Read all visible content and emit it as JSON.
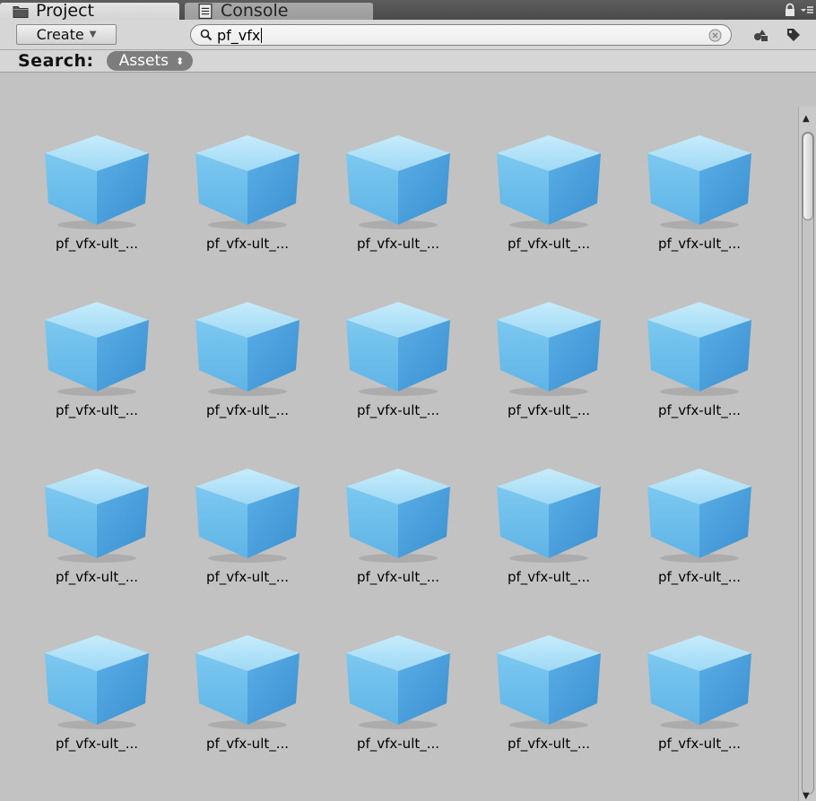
{
  "tabs": [
    {
      "label": "Project",
      "icon": "folder-icon",
      "active": true
    },
    {
      "label": "Console",
      "icon": "console-icon",
      "active": false
    }
  ],
  "tabbar_icons": [
    "lock-icon",
    "panel-menu-icon"
  ],
  "toolbar": {
    "create_label": "Create",
    "search_value": "pf_vfx",
    "filter_icons": [
      "filter-by-type-icon",
      "filter-by-label-icon"
    ]
  },
  "search_scope": {
    "label": "Search:",
    "value": "Assets"
  },
  "assets": [
    {
      "name": "pf_vfx-ult_...",
      "icon": "prefab-cube-icon"
    },
    {
      "name": "pf_vfx-ult_...",
      "icon": "prefab-cube-icon"
    },
    {
      "name": "pf_vfx-ult_...",
      "icon": "prefab-cube-icon"
    },
    {
      "name": "pf_vfx-ult_...",
      "icon": "prefab-cube-icon"
    },
    {
      "name": "pf_vfx-ult_...",
      "icon": "prefab-cube-icon"
    },
    {
      "name": "pf_vfx-ult_...",
      "icon": "prefab-cube-icon"
    },
    {
      "name": "pf_vfx-ult_...",
      "icon": "prefab-cube-icon"
    },
    {
      "name": "pf_vfx-ult_...",
      "icon": "prefab-cube-icon"
    },
    {
      "name": "pf_vfx-ult_...",
      "icon": "prefab-cube-icon"
    },
    {
      "name": "pf_vfx-ult_...",
      "icon": "prefab-cube-icon"
    },
    {
      "name": "pf_vfx-ult_...",
      "icon": "prefab-cube-icon"
    },
    {
      "name": "pf_vfx-ult_...",
      "icon": "prefab-cube-icon"
    },
    {
      "name": "pf_vfx-ult_...",
      "icon": "prefab-cube-icon"
    },
    {
      "name": "pf_vfx-ult_...",
      "icon": "prefab-cube-icon"
    },
    {
      "name": "pf_vfx-ult_...",
      "icon": "prefab-cube-icon"
    },
    {
      "name": "pf_vfx-ult_...",
      "icon": "prefab-cube-icon"
    },
    {
      "name": "pf_vfx-ult_...",
      "icon": "prefab-cube-icon"
    },
    {
      "name": "pf_vfx-ult_...",
      "icon": "prefab-cube-icon"
    },
    {
      "name": "pf_vfx-ult_...",
      "icon": "prefab-cube-icon"
    },
    {
      "name": "pf_vfx-ult_...",
      "icon": "prefab-cube-icon"
    }
  ],
  "colors": {
    "panel_bg": "#c2c2c2",
    "cube_top": "#9fd9f5",
    "cube_left": "#5fb4e6",
    "cube_right": "#3a8fd0"
  }
}
